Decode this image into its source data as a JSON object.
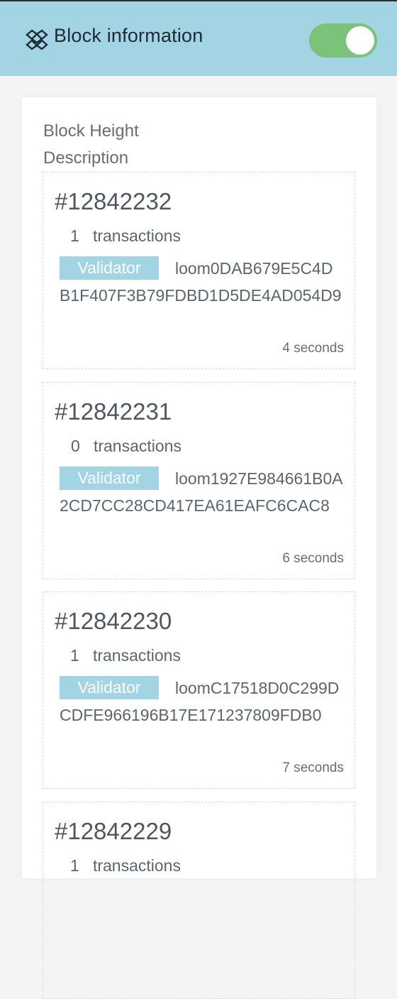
{
  "header": {
    "title": "Block information",
    "toggle_on": true
  },
  "panel": {
    "label_height": "Block Height",
    "label_description": "Description"
  },
  "blocks": [
    {
      "number": "#12842232",
      "tx_count": "1",
      "tx_label": "transactions",
      "validator_label": "Validator",
      "validator_address": "loom0DAB679E5C4DB1F407F3B79FDBD1D5DE4AD054D9",
      "time": "4 seconds"
    },
    {
      "number": "#12842231",
      "tx_count": "0",
      "tx_label": "transactions",
      "validator_label": "Validator",
      "validator_address": "loom1927E984661B0A2CD7CC28CD417EA61EAFC6CAC8",
      "time": "6 seconds"
    },
    {
      "number": "#12842230",
      "tx_count": "1",
      "tx_label": "transactions",
      "validator_label": "Validator",
      "validator_address": "loomC17518D0C299DCDFE966196B17E171237809FDB0",
      "time": "7 seconds"
    },
    {
      "number": "#12842229",
      "tx_count": "1",
      "tx_label": "transactions"
    }
  ],
  "colors": {
    "header_bg": "#a2d4e3",
    "toggle_on": "#7bc27a",
    "badge_bg": "#a2d4e3"
  }
}
